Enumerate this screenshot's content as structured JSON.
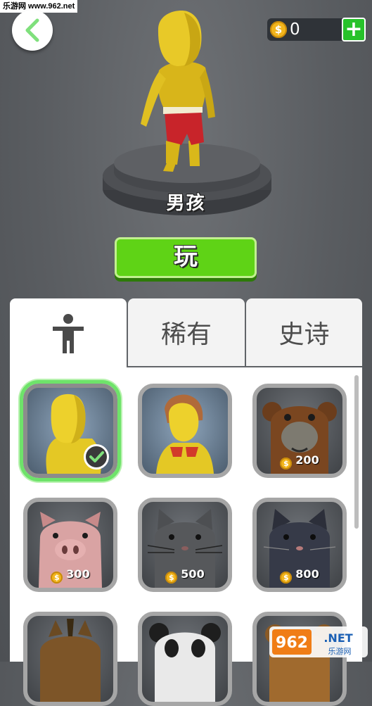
{
  "watermark": {
    "top": "乐游网 www.962.net",
    "bottom_logo": "962.NET",
    "bottom_sub": "乐游网"
  },
  "header": {
    "coins": "0",
    "coin_symbol": "$",
    "add_label": "+"
  },
  "character": {
    "name": "男孩"
  },
  "play_button": {
    "label": "玩"
  },
  "tabs": [
    {
      "label": "",
      "icon": "person-icon",
      "active": true
    },
    {
      "label": "稀有",
      "active": false
    },
    {
      "label": "史诗",
      "active": false
    }
  ],
  "skins": [
    {
      "name": "yellow-boy",
      "price": "",
      "selected": true
    },
    {
      "name": "girl",
      "price": "",
      "selected": false
    },
    {
      "name": "monkey",
      "price": "200"
    },
    {
      "name": "pig",
      "price": "300"
    },
    {
      "name": "gray-cat",
      "price": "500"
    },
    {
      "name": "dark-cat",
      "price": "800"
    },
    {
      "name": "horse",
      "price": ""
    },
    {
      "name": "panda",
      "price": ""
    },
    {
      "name": "bear",
      "price": ""
    }
  ],
  "colors": {
    "play_green": "#5fd316",
    "selected_glow": "#6ee36a",
    "coin": "#f2b51c",
    "accent_add": "#27c22a"
  }
}
